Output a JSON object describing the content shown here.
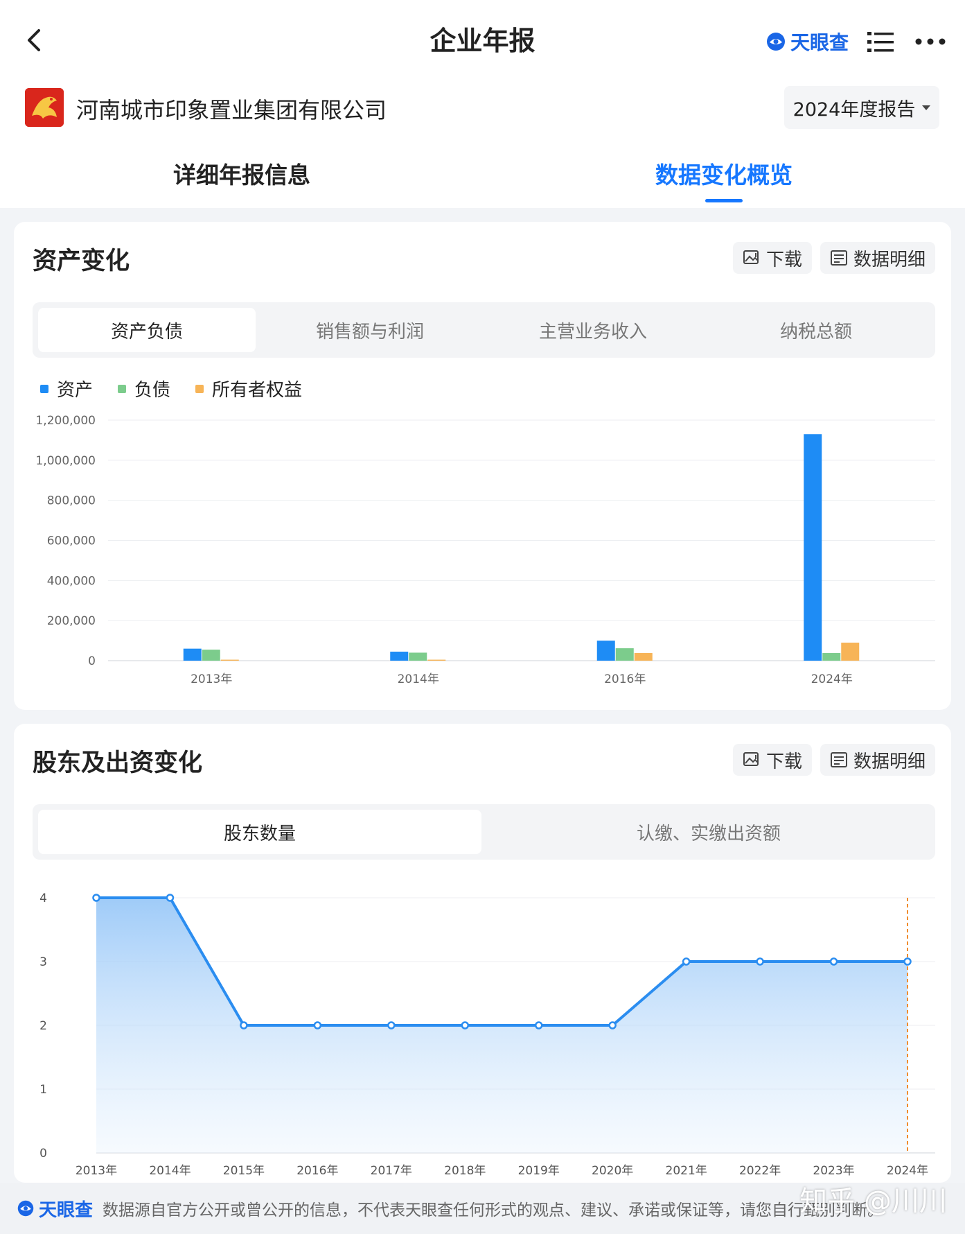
{
  "header": {
    "title": "企业年报",
    "brand": "天眼查"
  },
  "company": {
    "name": "河南城市印象置业集团有限公司",
    "report_year": "2024年度报告"
  },
  "tabs": [
    {
      "label": "详细年报信息",
      "active": false
    },
    {
      "label": "数据变化概览",
      "active": true
    }
  ],
  "assets_card": {
    "title": "资产变化",
    "download_label": "下载",
    "detail_label": "数据明细",
    "segments": [
      "资产负债",
      "销售额与利润",
      "主营业务收入",
      "纳税总额"
    ],
    "active_segment": 0
  },
  "shareholder_card": {
    "title": "股东及出资变化",
    "download_label": "下载",
    "detail_label": "数据明细",
    "segments": [
      "股东数量",
      "认缴、实缴出资额"
    ],
    "active_segment": 0
  },
  "chart_data": [
    {
      "type": "bar",
      "categories": [
        "2013年",
        "2014年",
        "2016年",
        "2024年"
      ],
      "series": [
        {
          "name": "资产",
          "color": "#1e8cf5",
          "values": [
            60000,
            45000,
            100000,
            1130000
          ]
        },
        {
          "name": "负债",
          "color": "#7ccc8c",
          "values": [
            55000,
            40000,
            62000,
            38000
          ]
        },
        {
          "name": "所有者权益",
          "color": "#f7b457",
          "values": [
            5000,
            5000,
            38000,
            90000
          ]
        }
      ],
      "yticks": [
        "0",
        "200,000",
        "400,000",
        "600,000",
        "800,000",
        "1,000,000",
        "1,200,000"
      ],
      "ylim": [
        0,
        1200000
      ],
      "grid": true,
      "legend": "top-left"
    },
    {
      "type": "area",
      "categories": [
        "2013年",
        "2014年",
        "2015年",
        "2016年",
        "2017年",
        "2018年",
        "2019年",
        "2020年",
        "2021年",
        "2022年",
        "2023年",
        "2024年"
      ],
      "series": [
        {
          "color": "#2b8df0",
          "values": [
            4,
            4,
            2,
            2,
            2,
            2,
            2,
            2,
            3,
            3,
            3,
            3
          ]
        }
      ],
      "yticks": [
        "0",
        "1",
        "2",
        "3",
        "4"
      ],
      "ylim": [
        0,
        4
      ],
      "grid": true,
      "highlight_line_color": "#f08c2e"
    }
  ],
  "footer": {
    "brand": "天眼查",
    "note": "数据源自官方公开或曾公开的信息，不代表天眼查任何形式的观点、建议、承诺或保证等，请您自行甄别判断。",
    "watermark": "知乎 @川川"
  }
}
